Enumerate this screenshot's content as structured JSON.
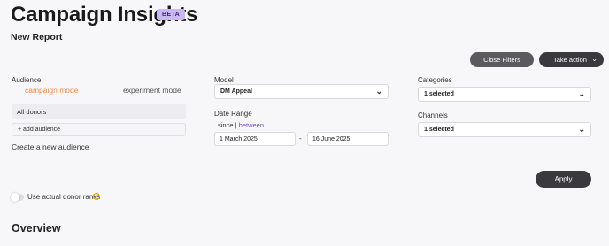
{
  "header": {
    "title": "Campaign Insights",
    "badge": "BETA",
    "report_title": "New Report"
  },
  "actions": {
    "close_filters": "Close Filters",
    "take_action": "Take action",
    "apply": "Apply"
  },
  "audience": {
    "label": "Audience",
    "modes": [
      "campaign mode",
      "experiment mode"
    ],
    "active_mode": "campaign mode",
    "selected": "All donors",
    "add_label": "+ add audience",
    "create_link": "Create a new audience"
  },
  "model": {
    "label": "Model",
    "value": "DM Appeal"
  },
  "date_range": {
    "label": "Date Range",
    "since": "since",
    "separator": "|",
    "between": "between",
    "start": "1 March 2025",
    "dash": "-",
    "end": "16 June 2025"
  },
  "categories": {
    "label": "Categories",
    "value": "1 selected"
  },
  "channels": {
    "label": "Channels",
    "value": "1 selected"
  },
  "donor_ranks": {
    "label": "Use actual donor ranks",
    "enabled": false
  },
  "overview": {
    "title": "Overview"
  },
  "colors": {
    "accent_orange": "#f0883e",
    "accent_purple": "#6b4fc9",
    "button_dark": "#3a3a3e",
    "badge_bg": "#c9b8f2"
  }
}
